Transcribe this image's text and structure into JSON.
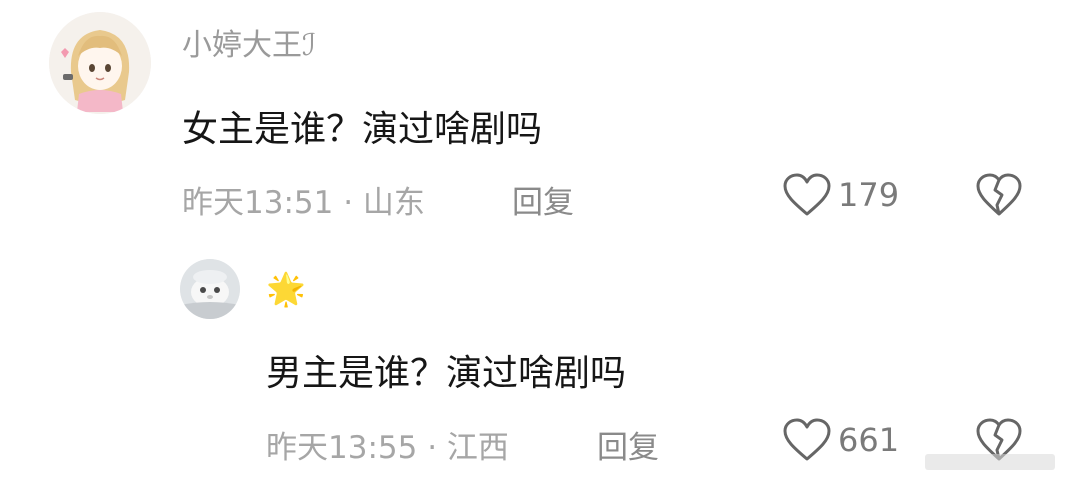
{
  "comments": [
    {
      "username": "小婷大王ℐ",
      "text": "女主是谁？演过啥剧吗",
      "meta": "昨天13:51 · 山东",
      "reply_label": "回复",
      "likes": "179"
    },
    {
      "username": "🌟",
      "text": "男主是谁？演过啥剧吗",
      "meta": "昨天13:55 · 江西",
      "reply_label": "回复",
      "likes": "661"
    }
  ],
  "icons": {
    "like": "heart-icon",
    "dislike": "broken-heart-icon"
  },
  "colors": {
    "username": "#9a9a9a",
    "comment_text": "#161616",
    "meta": "#a6a6a6",
    "icon": "#666666"
  }
}
